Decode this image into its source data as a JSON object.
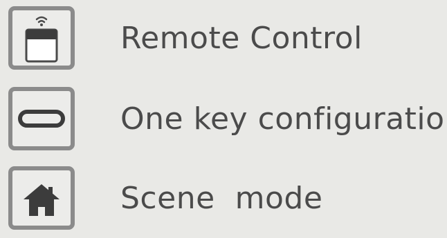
{
  "menu": {
    "items": [
      {
        "label": "Remote Control",
        "icon": "remote-control-icon"
      },
      {
        "label": "One key configuration",
        "icon": "one-key-button-icon"
      },
      {
        "label": "Scene  mode",
        "icon": "home-icon"
      }
    ]
  },
  "colors": {
    "background": "#e9e9e6",
    "icon_border": "#8b8b8b",
    "icon_fill": "#4a4a4a",
    "text": "#4b4b4b"
  }
}
